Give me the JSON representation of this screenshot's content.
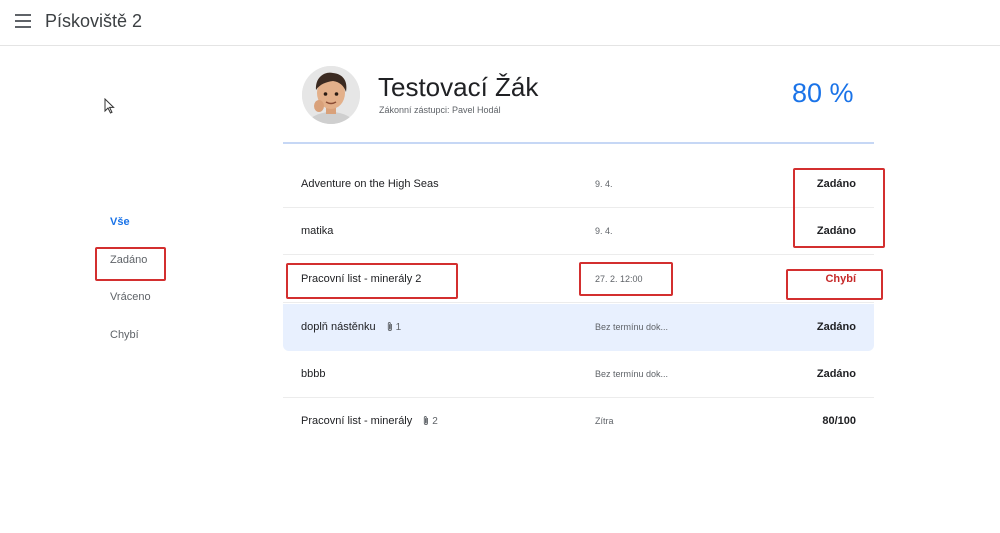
{
  "app": {
    "title": "Pískoviště 2"
  },
  "filters": [
    {
      "label": "Vše",
      "active": true
    },
    {
      "label": "Zadáno",
      "active": false
    },
    {
      "label": "Vráceno",
      "active": false
    },
    {
      "label": "Chybí",
      "active": false
    }
  ],
  "student": {
    "name": "Testovací Žák",
    "guardian": "Zákonní zástupci: Pavel Hodál",
    "percent": "80 %"
  },
  "assignments": [
    {
      "title": "Adventure on the High Seas",
      "due": "9. 4.",
      "status": "Zadáno",
      "attachments": ""
    },
    {
      "title": "matika",
      "due": "9. 4.",
      "status": "Zadáno",
      "attachments": ""
    },
    {
      "title": "Pracovní list - minerály 2",
      "due": "27. 2. 12:00",
      "status": "Chybí",
      "attachments": ""
    },
    {
      "title": "doplň nástěnku",
      "due": "Bez termínu dok...",
      "status": "Zadáno",
      "attachments": "1"
    },
    {
      "title": "bbbb",
      "due": "Bez termínu dok...",
      "status": "Zadáno",
      "attachments": ""
    },
    {
      "title": "Pracovní list - minerály",
      "due": "Zítra",
      "status": "80/100",
      "attachments": "2"
    }
  ],
  "colors": {
    "accent": "#1a73e8",
    "missing": "#c62828",
    "annotation": "#d32f2f",
    "highlight": "#e8f0fe"
  }
}
